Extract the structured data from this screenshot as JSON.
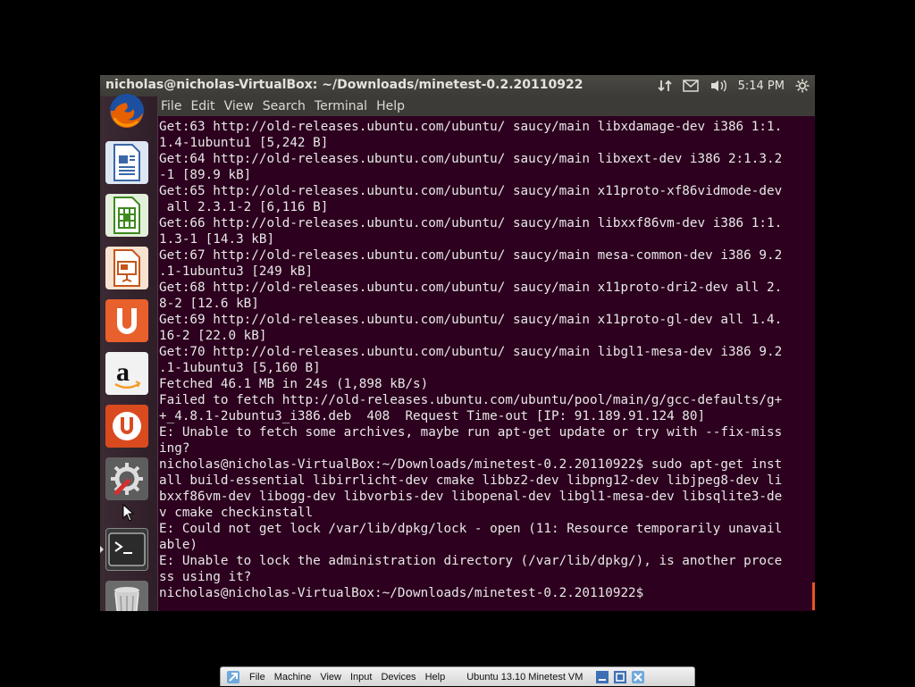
{
  "window": {
    "title": "nicholas@nicholas-VirtualBox: ~/Downloads/minetest-0.2.20110922"
  },
  "indicators": {
    "clock": "5:14 PM"
  },
  "menu": [
    "File",
    "Edit",
    "View",
    "Search",
    "Terminal",
    "Help"
  ],
  "launcher": [
    {
      "name": "firefox-icon"
    },
    {
      "name": "libreoffice-writer-icon"
    },
    {
      "name": "libreoffice-calc-icon"
    },
    {
      "name": "libreoffice-impress-icon"
    },
    {
      "name": "ubuntu-software-center-icon"
    },
    {
      "name": "amazon-icon"
    },
    {
      "name": "ubuntu-one-icon"
    },
    {
      "name": "system-settings-icon"
    },
    {
      "name": "terminal-icon"
    },
    {
      "name": "trash-icon"
    }
  ],
  "terminal": {
    "lines": [
      "Get:63 http://old-releases.ubuntu.com/ubuntu/ saucy/main libxdamage-dev i386 1:1.",
      "1.4-1ubuntu1 [5,242 B]",
      "Get:64 http://old-releases.ubuntu.com/ubuntu/ saucy/main libxext-dev i386 2:1.3.2",
      "-1 [89.9 kB]",
      "Get:65 http://old-releases.ubuntu.com/ubuntu/ saucy/main x11proto-xf86vidmode-dev",
      " all 2.3.1-2 [6,116 B]",
      "Get:66 http://old-releases.ubuntu.com/ubuntu/ saucy/main libxxf86vm-dev i386 1:1.",
      "1.3-1 [14.3 kB]",
      "Get:67 http://old-releases.ubuntu.com/ubuntu/ saucy/main mesa-common-dev i386 9.2",
      ".1-1ubuntu3 [249 kB]",
      "Get:68 http://old-releases.ubuntu.com/ubuntu/ saucy/main x11proto-dri2-dev all 2.",
      "8-2 [12.6 kB]",
      "Get:69 http://old-releases.ubuntu.com/ubuntu/ saucy/main x11proto-gl-dev all 1.4.",
      "16-2 [22.0 kB]",
      "Get:70 http://old-releases.ubuntu.com/ubuntu/ saucy/main libgl1-mesa-dev i386 9.2",
      ".1-1ubuntu3 [5,160 B]",
      "Fetched 46.1 MB in 24s (1,898 kB/s)",
      "Failed to fetch http://old-releases.ubuntu.com/ubuntu/pool/main/g/gcc-defaults/g+",
      "+_4.8.1-2ubuntu3_i386.deb  408  Request Time-out [IP: 91.189.91.124 80]",
      "E: Unable to fetch some archives, maybe run apt-get update or try with --fix-miss",
      "ing?",
      "nicholas@nicholas-VirtualBox:~/Downloads/minetest-0.2.20110922$ sudo apt-get inst",
      "all build-essential libirrlicht-dev cmake libbz2-dev libpng12-dev libjpeg8-dev li",
      "bxxf86vm-dev libogg-dev libvorbis-dev libopenal-dev libgl1-mesa-dev libsqlite3-de",
      "v cmake checkinstall",
      "E: Could not get lock /var/lib/dpkg/lock - open (11: Resource temporarily unavail",
      "able)",
      "E: Unable to lock the administration directory (/var/lib/dpkg/), is another proce",
      "ss using it?",
      "nicholas@nicholas-VirtualBox:~/Downloads/minetest-0.2.20110922$ "
    ]
  },
  "vbox": {
    "menu": [
      "File",
      "Machine",
      "View",
      "Input",
      "Devices",
      "Help"
    ],
    "title": "Ubuntu 13.10 Minetest VM"
  }
}
